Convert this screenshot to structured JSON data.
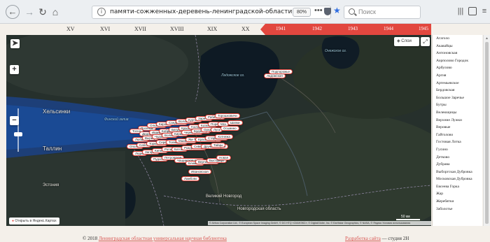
{
  "browser": {
    "url": "памяти-сожженных-деревень-ленинградской-области.рф",
    "zoom": "80%",
    "search_placeholder": "Поиск",
    "more": "•••"
  },
  "timeline": {
    "centuries": [
      "XV",
      "XVI",
      "XVII",
      "XVIII",
      "XIX",
      "XX"
    ],
    "years": [
      "1941",
      "1942",
      "1943",
      "1944",
      "1945"
    ],
    "accent_color": "#e2473f"
  },
  "map": {
    "layers_label": "Слои",
    "open_in_yandex": "Открыть в Яндекс.Картах",
    "copyright": "© Airbus Corporation Ltd., © European Space Imaging GmbH, © DG HTQ «СКАНЭКС», © DigitalGlobe, Inc. © Earthstar Geographics, © NASA, © Яндекс Условия использования",
    "scale": "50 км",
    "city_labels": [
      {
        "text": "Хельсинки",
        "style": "big"
      },
      {
        "text": "Таллин",
        "style": "big"
      },
      {
        "text": "Великий Новгород",
        "style": ""
      },
      {
        "text": "Ладожское оз.",
        "style": "italic"
      },
      {
        "text": "Финский залив",
        "style": "italic"
      },
      {
        "text": "Эстония",
        "style": ""
      },
      {
        "text": "Новгородская область",
        "style": ""
      },
      {
        "text": "Онежское оз.",
        "style": "italic"
      }
    ],
    "markers": [
      "Ладожская",
      "Подпорожье",
      "Поселок",
      "Ольховка",
      "Кирово",
      "Сандалово",
      "Волосово",
      "Кургово",
      "Заречье",
      "Рабитицы",
      "Торошковичи",
      "Тосно",
      "Дедово",
      "Ивановское",
      "Кобрино",
      "Бегуницы",
      "Красницы",
      "Гостилицы",
      "Котелово",
      "Поречье",
      "Мга",
      "Шапки",
      "Любань",
      "Вырица",
      "Чудово",
      "Волхов",
      "Кириши",
      "Чернецкое",
      "Будогощь",
      "Оредеж",
      "Луга",
      "Осьмино",
      "Ополье",
      "Сабск",
      "Торковичи",
      "Серебрянка",
      "Толмачево",
      "Мшинская",
      "Ям-Тесово",
      "Красные Горы",
      "Старополье",
      "Хотнежа",
      "Лядно",
      "Загорье",
      "Кипень",
      "Ропша",
      "Батово",
      "Рождествено",
      "Сиверский",
      "Дружная Горка",
      "Тайцы",
      "Пудость",
      "Петровская",
      "Чащинское поле",
      "Ближнее",
      "Вертильные",
      "Быстрица",
      "Новая",
      "Ивановская",
      "Ламбово"
    ]
  },
  "villages": [
    "Агаголо",
    "Акавайцы",
    "Антоновская",
    "Аорполово Городок",
    "Арбулово",
    "Аргия",
    "Артемьевское",
    "Бердовская",
    "Большое Заречье",
    "Бутры",
    "Велеющицы",
    "Верхние Лужки",
    "Веровые",
    "Гайтолово",
    "Гостовая Лотка",
    "Гусино",
    "Детково",
    "Дубрава",
    "Выборгская Дубровка",
    "Московская Дубровка",
    "Евсеева Горка",
    "Жар",
    "Жеребятки",
    "Заболотье"
  ],
  "footer": {
    "copyright_prefix": "© 2018 ",
    "library_link": "Ленинградская областная универсальная научная библиотека",
    "dev_link": "Разработка сайта",
    "studio": " — студия 2Н"
  }
}
